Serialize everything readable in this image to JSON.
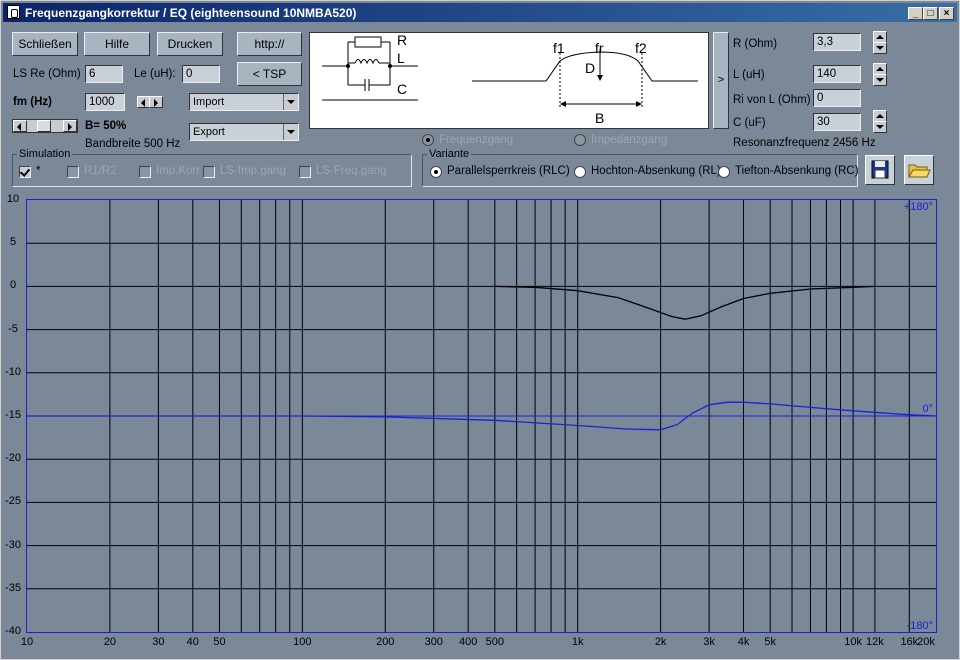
{
  "window": {
    "title": "Frequenzgangkorrektur / EQ (eighteensound 10NMBA520)"
  },
  "buttons": {
    "close": "Schließen",
    "help": "Hilfe",
    "print": "Drucken",
    "http": "http://",
    "tsp": "< TSP"
  },
  "fields": {
    "ls_re_label": "LS Re (Ohm)",
    "ls_re_value": "6",
    "le_label": "Le (uH):",
    "le_value": "0",
    "fm_label": "fm (Hz)",
    "fm_value": "1000",
    "bandwidth_pct": "B= 50%",
    "bandwidth_hz": "Bandbreite 500 Hz",
    "import": "Import",
    "export": "Export"
  },
  "right_panel": {
    "r_label": "R (Ohm)",
    "r_value": "3,3",
    "l_label": "L (uH)",
    "l_value": "140",
    "ri_label": "Ri von L (Ohm)",
    "ri_value": "0",
    "c_label": "C (uF)",
    "c_value": "30",
    "resonance": "Resonanzfrequenz  2456 Hz",
    "toggle": ">"
  },
  "mode": {
    "freq": "Frequenzgang",
    "imp": "Impedanzgang"
  },
  "simulation": {
    "title": "Simulation",
    "items": [
      "*",
      "R1/R2",
      "Imp.Korr.",
      "LS-Imp.gang",
      "LS-Freq.gang"
    ]
  },
  "variante": {
    "title": "Variante",
    "options": [
      "Parallelsperrkreis (RLC)",
      "Hochton-Absenkung (RL)",
      "Tiefton-Absenkung (RC)"
    ],
    "selected": 0
  },
  "diagram": {
    "r": "R",
    "l": "L",
    "c": "C",
    "f1": "f1",
    "fr": "fr",
    "f2": "f2",
    "d": "D",
    "b": "B"
  },
  "chart_data": {
    "type": "line",
    "x_scale": "log",
    "xlim": [
      10,
      20000
    ],
    "ylim": [
      -40,
      10
    ],
    "grid": true,
    "y_ticks": [
      10,
      5,
      0,
      -5,
      -10,
      -15,
      -20,
      -25,
      -30,
      -35,
      -40
    ],
    "x_tick_labels": [
      {
        "v": 10,
        "t": "10"
      },
      {
        "v": 20,
        "t": "20"
      },
      {
        "v": 30,
        "t": "30"
      },
      {
        "v": 40,
        "t": "40"
      },
      {
        "v": 50,
        "t": "50"
      },
      {
        "v": 100,
        "t": "100"
      },
      {
        "v": 200,
        "t": "200"
      },
      {
        "v": 300,
        "t": "300"
      },
      {
        "v": 400,
        "t": "400"
      },
      {
        "v": 500,
        "t": "500"
      },
      {
        "v": 1000,
        "t": "1k"
      },
      {
        "v": 2000,
        "t": "2k"
      },
      {
        "v": 3000,
        "t": "3k"
      },
      {
        "v": 4000,
        "t": "4k"
      },
      {
        "v": 5000,
        "t": "5k"
      },
      {
        "v": 10000,
        "t": "10k"
      },
      {
        "v": 12000,
        "t": "12k"
      },
      {
        "v": 16000,
        "t": "16k"
      },
      {
        "v": 20000,
        "t": "20k"
      }
    ],
    "phase_labels": {
      "top": "+180°",
      "mid": "0°",
      "bottom": "-180°"
    },
    "series": [
      {
        "color": "#000000",
        "x": [
          500,
          700,
          1000,
          1400,
          1800,
          2200,
          2456,
          2800,
          3300,
          4000,
          5000,
          7000,
          10000,
          12000
        ],
        "y": [
          0,
          -0.1,
          -0.5,
          -1.3,
          -2.5,
          -3.5,
          -3.8,
          -3.4,
          -2.4,
          -1.4,
          -0.8,
          -0.3,
          -0.1,
          0
        ]
      },
      {
        "color": "#1a22d8",
        "x": [
          10,
          50,
          100,
          200,
          500,
          1000,
          1500,
          2000,
          2300,
          2600,
          3000,
          3500,
          4000,
          5000,
          7000,
          10000,
          15000,
          20000
        ],
        "y": [
          -15,
          -15,
          -15,
          -15.1,
          -15.5,
          -16.1,
          -16.5,
          -16.6,
          -16.0,
          -14.7,
          -13.7,
          -13.4,
          -13.4,
          -13.6,
          -14.0,
          -14.4,
          -14.8,
          -15.0
        ]
      }
    ]
  }
}
